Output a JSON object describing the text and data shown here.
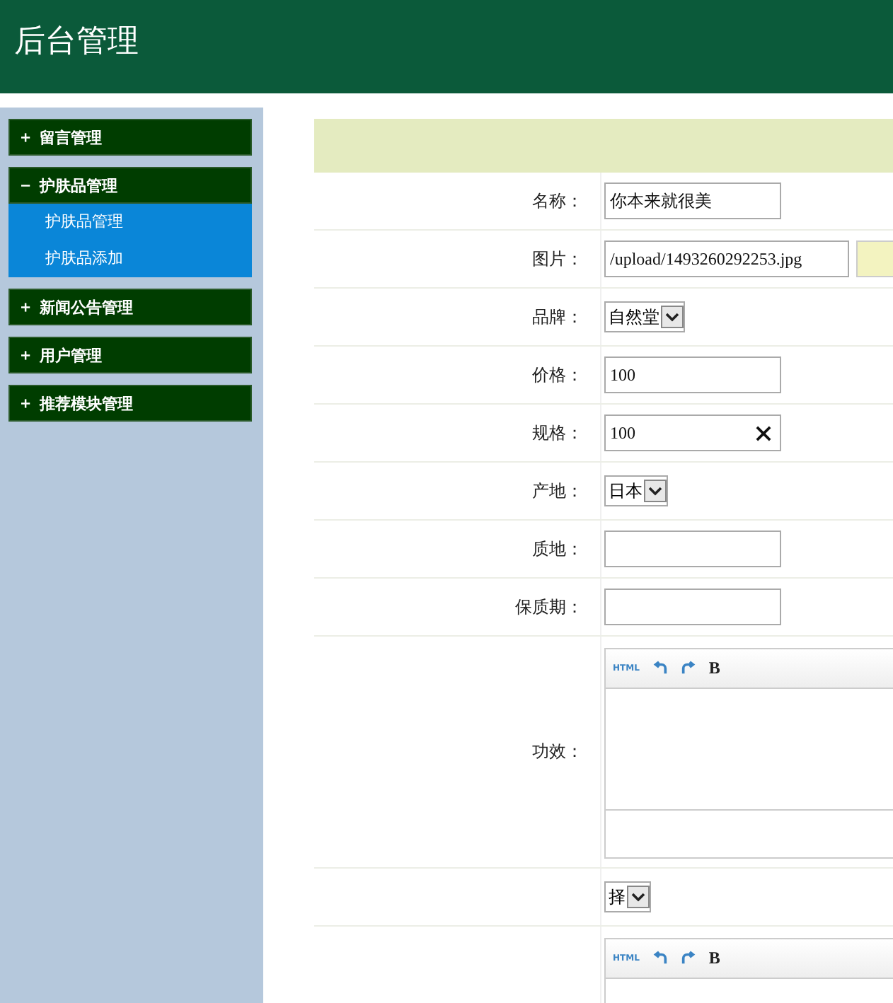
{
  "header": {
    "title": "后台管理"
  },
  "sidebar": {
    "groups": [
      {
        "label": "留言管理",
        "expanded": false
      },
      {
        "label": "护肤品管理",
        "expanded": true,
        "children": [
          {
            "label": "护肤品管理"
          },
          {
            "label": "护肤品添加"
          }
        ]
      },
      {
        "label": "新闻公告管理",
        "expanded": false
      },
      {
        "label": "用户管理",
        "expanded": false
      },
      {
        "label": "推荐模块管理",
        "expanded": false
      }
    ]
  },
  "form": {
    "rows": [
      {
        "kind": "text",
        "label": "名称：",
        "value": "你本来就很美"
      },
      {
        "kind": "upload",
        "label": "图片：",
        "value": "/upload/1493260292253.jpg"
      },
      {
        "kind": "select",
        "label": "品牌：",
        "value": "自然堂"
      },
      {
        "kind": "text",
        "label": "价格：",
        "value": "100"
      },
      {
        "kind": "clearable",
        "label": "规格：",
        "value": "100"
      },
      {
        "kind": "select",
        "label": "产地：",
        "value": "日本"
      },
      {
        "kind": "text",
        "label": "质地："
      },
      {
        "kind": "text",
        "label": "保质期："
      },
      {
        "kind": "editor",
        "label": "功效：",
        "tools": [
          {
            "kind": "text",
            "label": "HTML"
          },
          {
            "kind": "undo"
          },
          {
            "kind": "redo"
          },
          {
            "kind": "bold",
            "label": "B"
          }
        ]
      },
      {
        "kind": "select",
        "value": "择"
      },
      {
        "kind": "editor",
        "tools": [
          {
            "kind": "text",
            "label": "HTML"
          },
          {
            "kind": "undo"
          },
          {
            "kind": "redo"
          },
          {
            "kind": "bold",
            "label": "B"
          }
        ]
      }
    ]
  }
}
